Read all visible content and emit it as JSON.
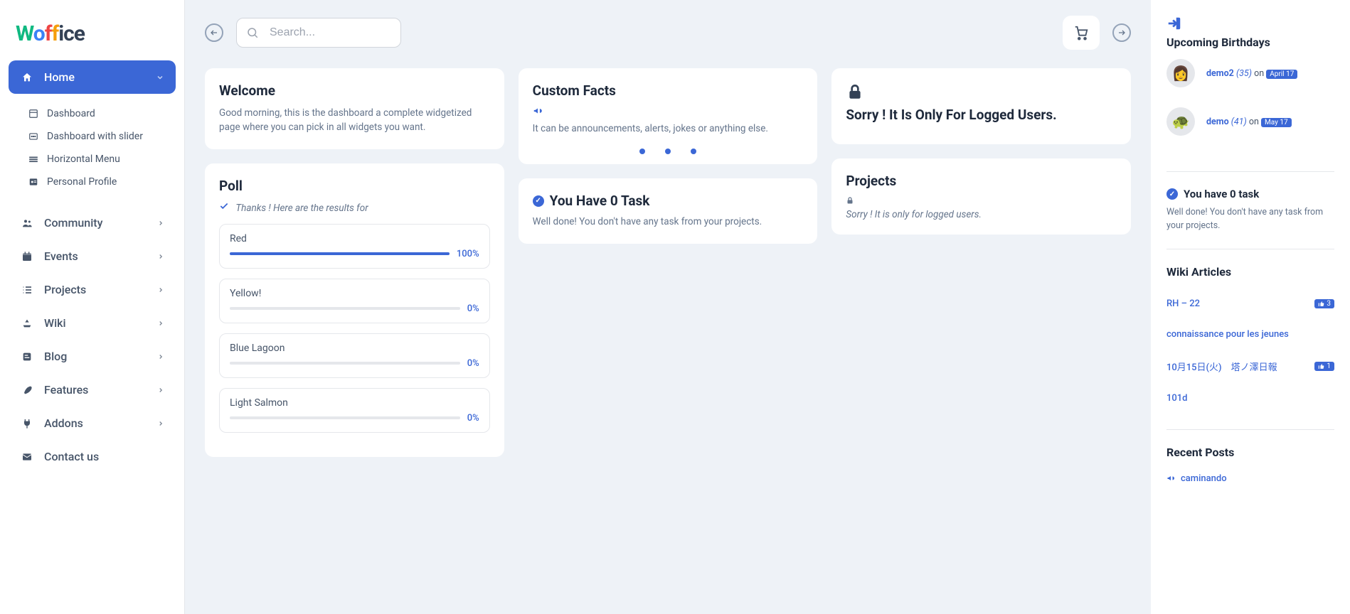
{
  "logo": {
    "text": "office"
  },
  "nav": {
    "home": "Home",
    "sub": [
      {
        "label": "Dashboard"
      },
      {
        "label": "Dashboard with slider"
      },
      {
        "label": "Horizontal Menu"
      },
      {
        "label": "Personal Profile"
      }
    ],
    "items": [
      {
        "label": "Community"
      },
      {
        "label": "Events"
      },
      {
        "label": "Projects"
      },
      {
        "label": "Wiki"
      },
      {
        "label": "Blog"
      },
      {
        "label": "Features"
      },
      {
        "label": "Addons"
      },
      {
        "label": "Contact us"
      }
    ]
  },
  "search": {
    "placeholder": "Search..."
  },
  "welcome": {
    "title": "Welcome",
    "desc": "Good morning, this is the dashboard a complete widgetized page where you can pick in all widgets you want."
  },
  "custom": {
    "title": "Custom Facts",
    "desc": "It can be announcements, alerts, jokes or anything else."
  },
  "locked": {
    "title": "Sorry ! It Is Only For Logged Users."
  },
  "poll": {
    "title": "Poll",
    "sub": "Thanks ! Here are the results for",
    "options": [
      {
        "label": "Red",
        "pct": "100%",
        "val": 100
      },
      {
        "label": "Yellow!",
        "pct": "0%",
        "val": 0
      },
      {
        "label": "Blue Lagoon",
        "pct": "0%",
        "val": 0
      },
      {
        "label": "Light Salmon",
        "pct": "0%",
        "val": 0
      }
    ]
  },
  "tasks": {
    "title": "You Have 0 Task",
    "desc": "Well done! You don't have any task from your projects."
  },
  "projects": {
    "title": "Projects",
    "desc": "Sorry ! It is only for logged users."
  },
  "side": {
    "birthdays": {
      "title": "Upcoming Birthdays",
      "list": [
        {
          "name": "demo2",
          "age": "(35)",
          "on": "on",
          "date": "April 17"
        },
        {
          "name": "demo",
          "age": "(41)",
          "on": "on",
          "date": "May 17"
        }
      ]
    },
    "task": {
      "title": "You have 0 task",
      "desc": "Well done! You don't have any task from your projects."
    },
    "wiki": {
      "title": "Wiki Articles",
      "list": [
        {
          "label": "RH – 22",
          "likes": "3"
        },
        {
          "label": "connaissance pour les jeunes",
          "likes": ""
        },
        {
          "label": "10月15日(火)　塔ノ澤日報",
          "likes": "1"
        },
        {
          "label": "101d",
          "likes": ""
        }
      ]
    },
    "posts": {
      "title": "Recent Posts",
      "list": [
        {
          "label": "caminando"
        }
      ]
    }
  }
}
